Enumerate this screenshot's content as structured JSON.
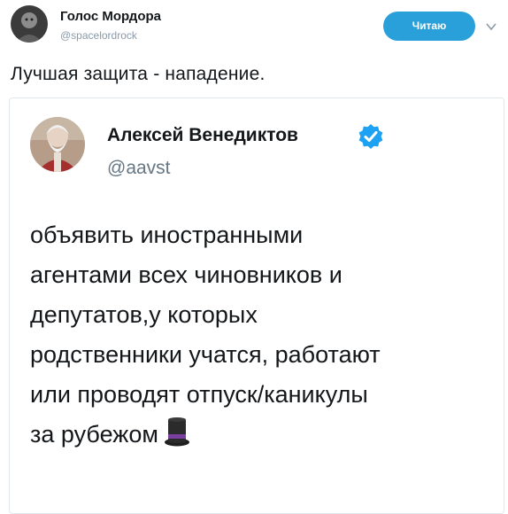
{
  "tweet": {
    "author_name": "Голос Мордора",
    "author_handle": "@spacelordrock",
    "follow_label": "Читаю",
    "text": "Лучшая защита - нападение."
  },
  "quoted_tweet": {
    "author_name": "Алексей Венедиктов",
    "author_handle": "@aavst",
    "verified": true,
    "text_lines": [
      "объявить иностранными",
      "агентами всех чиновников и",
      "депутатов,у которых",
      "родственники учатся, работают",
      "или проводят отпуск/каникулы",
      "за рубежом"
    ],
    "trailing_emoji": "top-hat"
  },
  "colors": {
    "follow_button": "#2aa0da",
    "verified_badge": "#1da1f2",
    "handle_gray": "#657786",
    "border": "#e1e8ed"
  },
  "icons": [
    "avatar",
    "chevron-down-icon",
    "verified-badge-icon",
    "top-hat-icon"
  ]
}
